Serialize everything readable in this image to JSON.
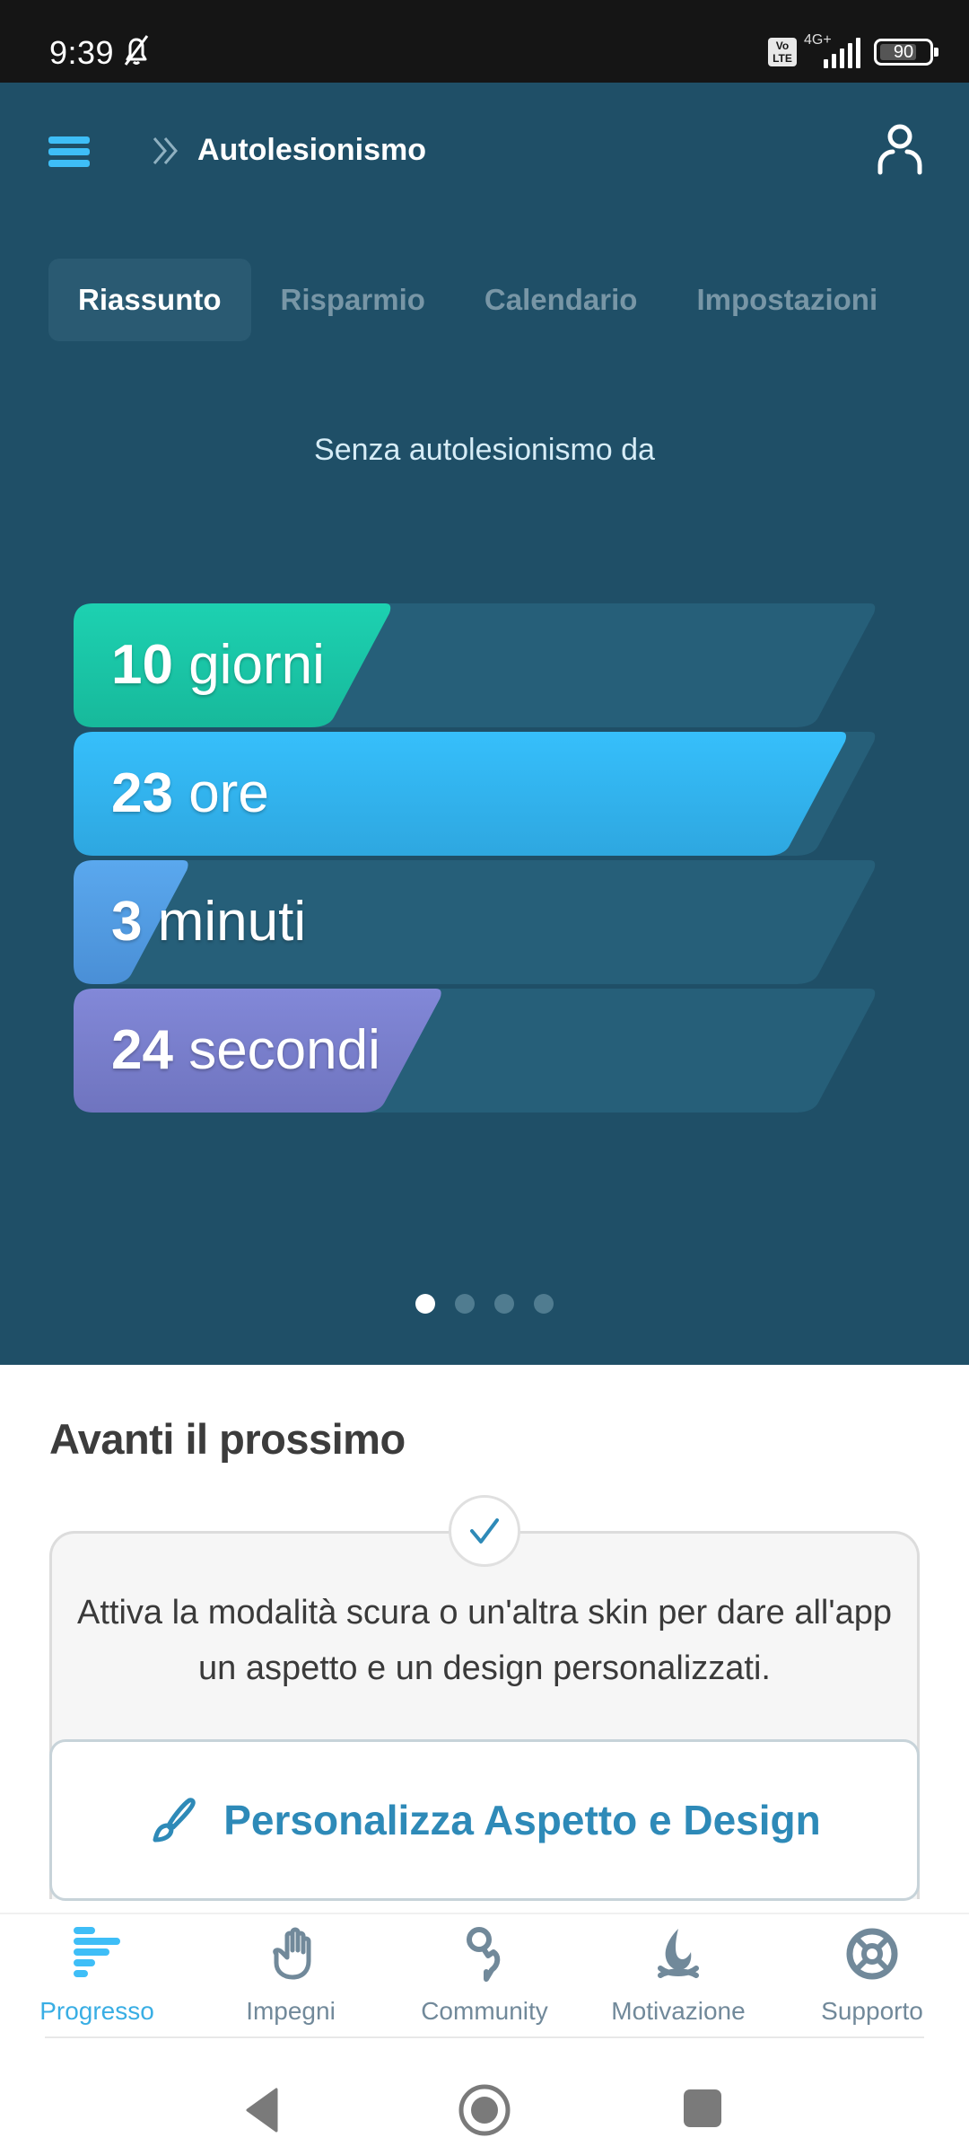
{
  "status_bar": {
    "time": "9:39",
    "volte": "Vo LTE",
    "network": "4G+",
    "battery": "90"
  },
  "header": {
    "menu_icon": "hamburger-menu-icon",
    "breadcrumb_icon": "double-chevron-right-icon",
    "title": "Autolesionismo",
    "profile_icon": "user-profile-icon"
  },
  "tabs": [
    {
      "label": "Riassunto",
      "active": true
    },
    {
      "label": "Risparmio",
      "active": false
    },
    {
      "label": "Calendario",
      "active": false
    },
    {
      "label": "Impostazioni",
      "active": false
    }
  ],
  "summary": {
    "since_label": "Senza autolesionismo da",
    "counters": [
      {
        "value": "10",
        "unit": "giorni",
        "fill_fraction": 0.33,
        "color_top": "#1dd1b1",
        "color_bottom": "#17b99b"
      },
      {
        "value": "23",
        "unit": "ore",
        "fill_fraction": 0.96,
        "color_top": "#36bffb",
        "color_bottom": "#2ea7e0"
      },
      {
        "value": "3",
        "unit": "minuti",
        "fill_fraction": 0.05,
        "color_top": "#5aa8ee",
        "color_bottom": "#4a8fd6"
      },
      {
        "value": "24",
        "unit": "secondi",
        "fill_fraction": 0.4,
        "color_top": "#8288d8",
        "color_bottom": "#6f74bf"
      }
    ],
    "track_color": "#265f79",
    "pager": {
      "total": 4,
      "active_index": 0
    }
  },
  "next": {
    "title": "Avanti il prossimo",
    "check_icon": "checkmark-icon",
    "text": "Attiva la modalità scura o un'altra skin per dare all'app un aspetto e un design personalizzati.",
    "button_icon": "paintbrush-icon",
    "button_label": "Personalizza Aspetto e Design"
  },
  "bottom_nav": [
    {
      "label": "Progresso",
      "icon": "progress-bars-icon",
      "active": true
    },
    {
      "label": "Impegni",
      "icon": "raised-hand-icon",
      "active": false
    },
    {
      "label": "Community",
      "icon": "community-chat-icon",
      "active": false
    },
    {
      "label": "Motivazione",
      "icon": "campfire-icon",
      "active": false
    },
    {
      "label": "Supporto",
      "icon": "lifebuoy-icon",
      "active": false
    }
  ],
  "colors": {
    "hero_bg": "#1f4f67",
    "accent": "#39aee4",
    "button_text": "#2e8ab8",
    "nav_inactive": "#71899a"
  }
}
